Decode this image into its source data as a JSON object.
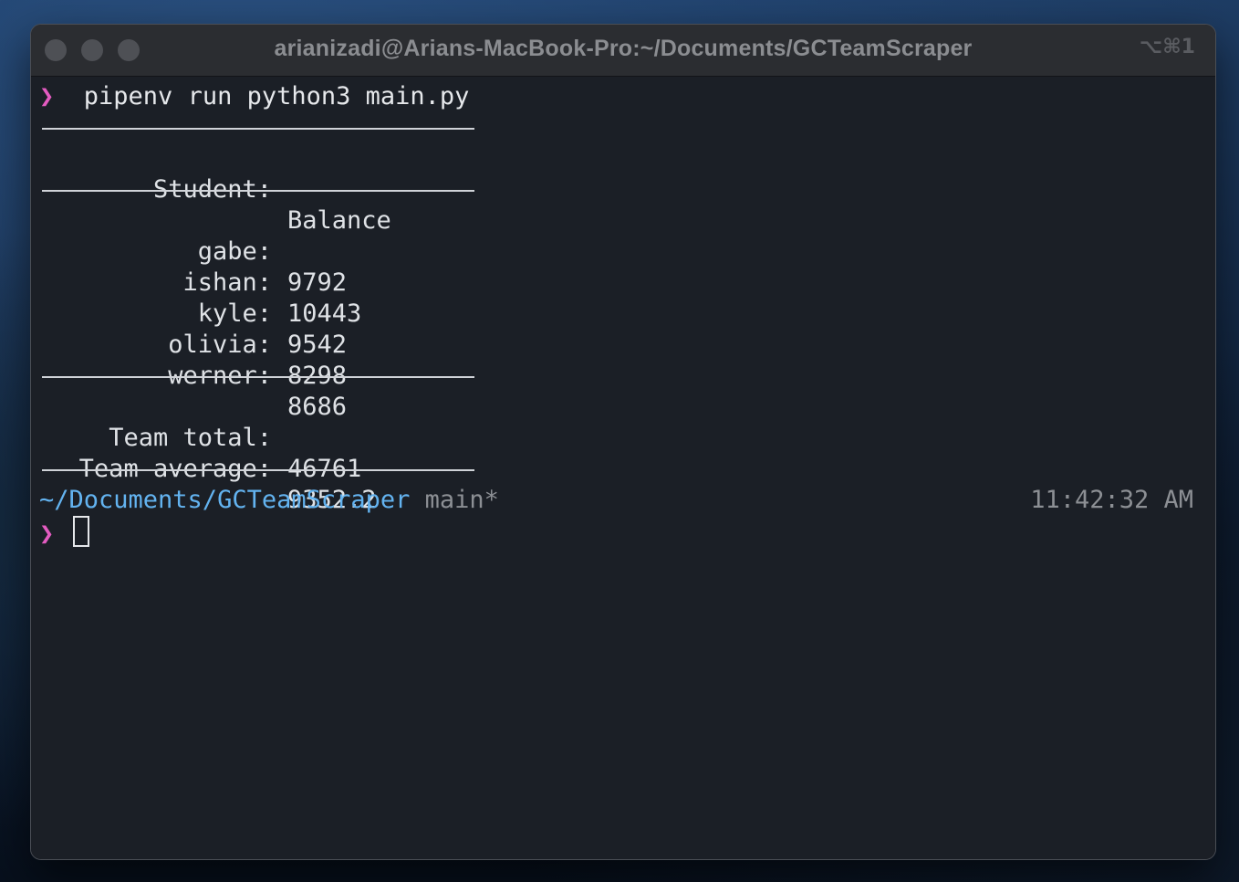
{
  "window": {
    "title": "arianizadi@Arians-MacBook-Pro:~/Documents/GCTeamScraper",
    "shortcut": "⌥⌘1"
  },
  "terminal": {
    "prompt_symbol": "❯",
    "command": "pipenv run python3 main.py",
    "table": {
      "header_key": "Student:",
      "header_value": "Balance",
      "rows": [
        {
          "key": "gabe:",
          "value": "9792"
        },
        {
          "key": "ishan:",
          "value": "10443"
        },
        {
          "key": "kyle:",
          "value": "9542"
        },
        {
          "key": "olivia:",
          "value": "8298"
        },
        {
          "key": "werner:",
          "value": "8686"
        }
      ],
      "summary": [
        {
          "key": "Team total:",
          "value": "46761"
        },
        {
          "key": "Team average:",
          "value": "9352.2"
        }
      ]
    },
    "status": {
      "path": "~/Documents/GCTeamScraper",
      "branch": "main*",
      "time": "11:42:32 AM"
    }
  }
}
